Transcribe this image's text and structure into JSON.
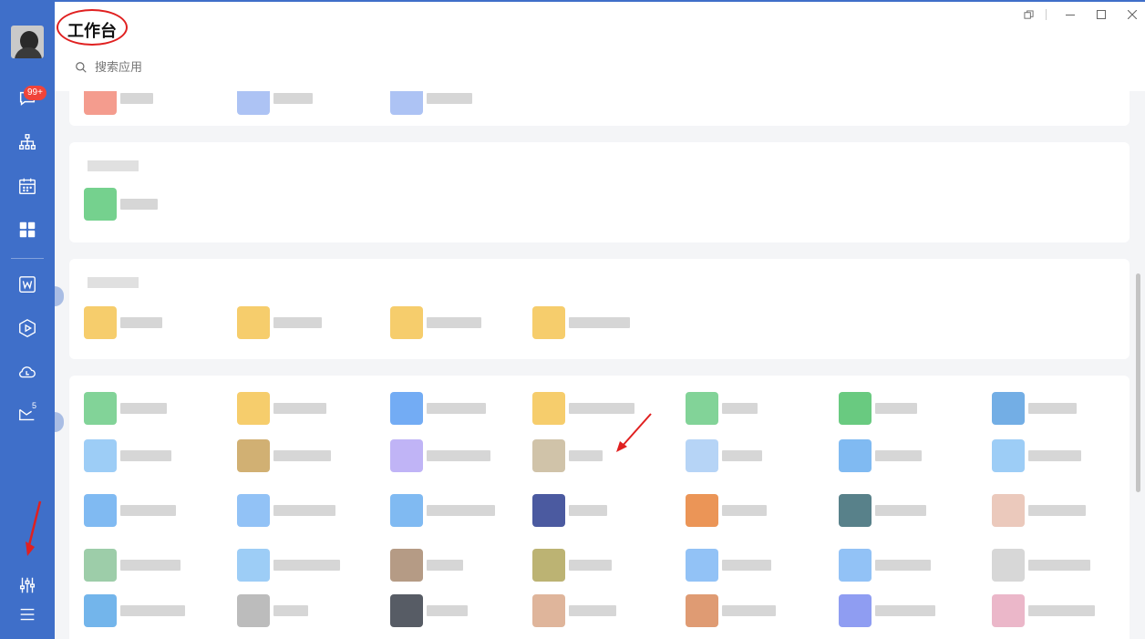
{
  "window": {
    "title": "工作台",
    "controls": [
      {
        "name": "restore-icon",
        "glyph": "⧉"
      },
      {
        "name": "separator",
        "glyph": "|"
      },
      {
        "name": "minimize-icon",
        "glyph": "—"
      },
      {
        "name": "maximize-icon",
        "glyph": "☐"
      },
      {
        "name": "close-icon",
        "glyph": "✕"
      }
    ]
  },
  "search": {
    "placeholder": "搜索应用"
  },
  "sidebar": {
    "message_badge": "99+",
    "mail_count": "5",
    "items": [
      {
        "name": "chat-icon"
      },
      {
        "name": "org-chart-icon"
      },
      {
        "name": "calendar-icon"
      },
      {
        "name": "workbench-grid-icon",
        "active": true
      },
      {
        "name": "word-doc-icon"
      },
      {
        "name": "hexagon-play-icon"
      },
      {
        "name": "cloud-icon"
      },
      {
        "name": "mail-icon"
      },
      {
        "name": "settings-sliders-icon"
      },
      {
        "name": "menu-icon"
      }
    ]
  },
  "colors": {
    "sidebar": "#3f6fc9",
    "annotation": "#e02020",
    "badge": "#f0443a"
  },
  "app_icon_colors": {
    "row_groups": [
      [
        "#f28b7a",
        "#9fb9f2",
        "#9fb9f2"
      ],
      [
        "#5dc97a"
      ],
      [
        "#f5c452",
        "#f5c452",
        "#f5c452",
        "#f5c452"
      ],
      [
        "#6ccb86",
        "#f5c452",
        "#5b9ef2",
        "#f5c452",
        "#6ccb86",
        "#4fc16a",
        "#5aa0e0"
      ],
      [
        "#8cc4f5",
        "#c9a25a",
        "#b5a7f5",
        "#c8b89a",
        "#a9cdf5",
        "#6aaef0",
        "#8cc4f5"
      ],
      [
        "#6aaef0",
        "#7fb7f5",
        "#6aaef0",
        "#2c3d8f",
        "#e8823a",
        "#3b6b75",
        "#e8c0b0"
      ],
      [
        "#8cc49a",
        "#8cc4f5",
        "#a88a70",
        "#b0a65a",
        "#7fb7f5",
        "#7fb7f5",
        "#d0d0d0"
      ],
      [
        "#5aa8e8",
        "#b0b0b0",
        "#3a3f4a",
        "#d9a88a",
        "#d98a5a",
        "#7b8cf0",
        "#e8aac0"
      ]
    ]
  }
}
